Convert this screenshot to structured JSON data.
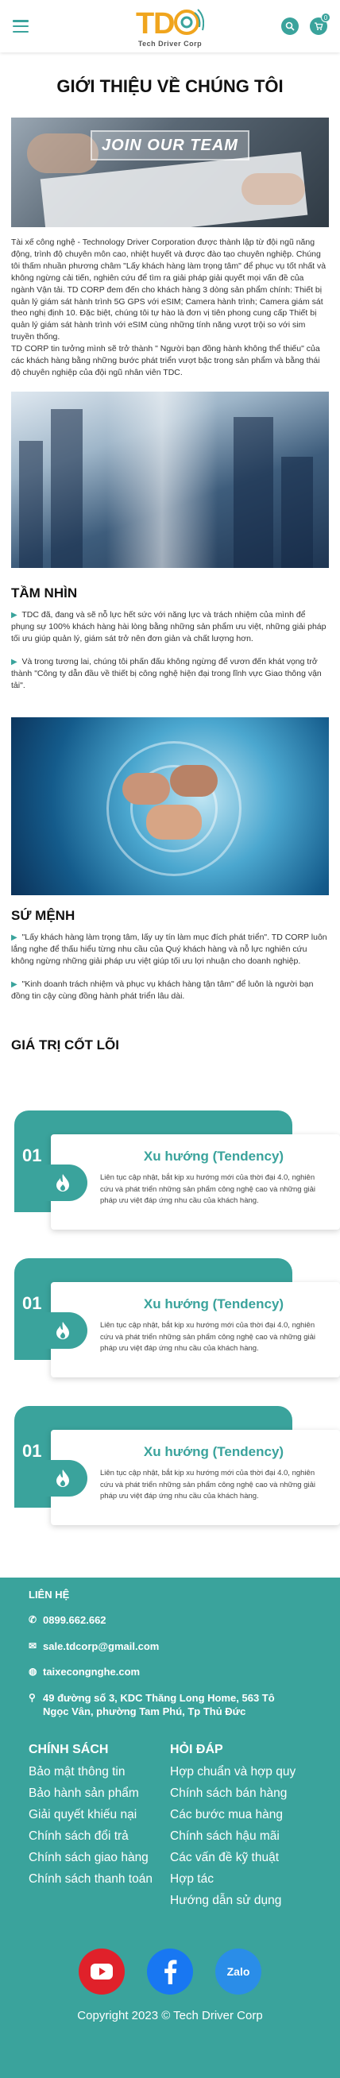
{
  "header": {
    "logo_text": "Tech Driver Corp",
    "cart_count": "0"
  },
  "page_title": "GIỚI THIỆU VỀ CHÚNG TÔI",
  "banner_text": "JOIN OUR TEAM",
  "intro": [
    "Tài xế công nghệ - Technology Driver Corporation  được thành lập từ đội ngũ năng động, trình độ chuyên môn cao, nhiệt huyết và được đào tạo chuyên nghiệp. Chúng tôi thấm nhuần phương châm \"Lấy khách hàng làm trọng tâm\" để phục vụ tốt nhất và không ngừng cải tiến, nghiên cứu để tìm ra giải pháp giải quyết mọi vấn đề của ngành Vận tải. TD CORP đem đến cho khách hàng 3 dòng sản phẩm chính: Thiết bị quản lý giám sát hành trình 5G GPS với eSIM; Camera hành trình; Camera giám sát theo nghị định 10. Đặc biệt, chúng tôi tự hào là đơn vị tiên phong cung cấp Thiết bị quản lý giám sát hành trình với  eSIM cùng những tính năng vượt trội so với sim truyền thống.",
    "TD CORP tin tưởng mình sẽ trở thành \" Người bạn đồng hành không thể thiếu\" của các khách hàng bằng những bước phát triển vượt bậc trong sản phẩm và bằng thái độ chuyên nghiệp của đội ngũ nhân viên TDC."
  ],
  "vision": {
    "heading": "TẦM NHÌN",
    "items": [
      "TDC đã, đang và sẽ nỗ lực hết sức với năng lực và trách nhiệm của mình để phụng sự 100% khách hàng hài lòng bằng những sản phẩm ưu việt, những giải pháp tối ưu giúp quản lý, giám sát trở nên  đơn giản và chất lượng hơn.",
      "Và trong tương lai, chúng tôi phấn đấu không ngừng để vươn đến khát vọng trở thành \"Công ty dẫn đầu về thiết bị công nghệ hiện đại trong lĩnh vực Giao thông vận tải\"."
    ]
  },
  "mission": {
    "heading": "SỨ MỆNH",
    "items": [
      "\"Lấy khách hàng làm trọng tâm, lấy uy tín làm mục đích phát triển\". TD CORP luôn lắng nghe để thấu hiểu từng nhu cầu của Quý khách hàng và nỗ lực nghiên cứu không ngừng những giải pháp ưu việt giúp tối ưu lợi nhuận cho doanh nghiệp.",
      "\"Kinh doanh trách nhiệm và phục vụ khách hàng tận tâm\" để luôn là người bạn đồng tin cậy cùng đồng hành phát triển lâu dài."
    ]
  },
  "values": {
    "heading": "GIÁ TRỊ CỐT LÕI",
    "cards": [
      {
        "num": "01",
        "title": "Xu hướng (Tendency)",
        "desc": "Liên tục cập nhật, bắt kịp xu hướng mới của thời đại 4.0, nghiên cứu và phát triển những sản phẩm công nghệ cao và những giải pháp ưu việt đáp ứng nhu cầu của khách hàng."
      },
      {
        "num": "01",
        "title": "Xu hướng (Tendency)",
        "desc": "Liên tục cập nhật, bắt kịp xu hướng mới của thời đại 4.0, nghiên cứu và phát triển những sản phẩm công nghệ cao và những giải pháp ưu việt đáp ứng nhu cầu của khách hàng."
      },
      {
        "num": "01",
        "title": "Xu hướng (Tendency)",
        "desc": "Liên tục cập nhật, bắt kịp xu hướng mới của thời đại 4.0, nghiên cứu và phát triển những sản phẩm công nghệ cao và những giải pháp ưu việt đáp ứng nhu cầu của khách hàng."
      }
    ]
  },
  "footer": {
    "contact_heading": "LIÊN HỆ",
    "phone": "0899.662.662",
    "email": "sale.tdcorp@gmail.com",
    "website": "taixecongnghe.com",
    "address": "49 đường số 3, KDC Thăng Long Home, 563 Tô Ngọc Vân, phường Tam Phú, Tp Thủ Đức",
    "policy_heading": "CHÍNH SÁCH",
    "policy_items": [
      "Bảo mật thông tin",
      "Bảo hành sản phẩm",
      "Giải quyết khiếu nại",
      "Chính sách đổi trả",
      "Chính sách giao hàng",
      "Chính sách thanh toán"
    ],
    "faq_heading": "HỎI ĐÁP",
    "faq_items": [
      "Hợp chuẩn và hợp quy",
      "Chính sách bán hàng",
      "Các bước mua hàng",
      "Chính sách hậu mãi",
      "Các vấn đề kỹ thuật",
      "Hợp tác",
      "Hướng dẫn sử dụng"
    ],
    "zalo_label": "Zalo",
    "copyright": "Copyright 2023 © Tech Driver Corp"
  },
  "colors": {
    "accent": "#3aa39c",
    "logo_orange": "#f0a51e",
    "youtube": "#e0212a",
    "facebook": "#1877f2",
    "zalo": "#2a8de8"
  }
}
